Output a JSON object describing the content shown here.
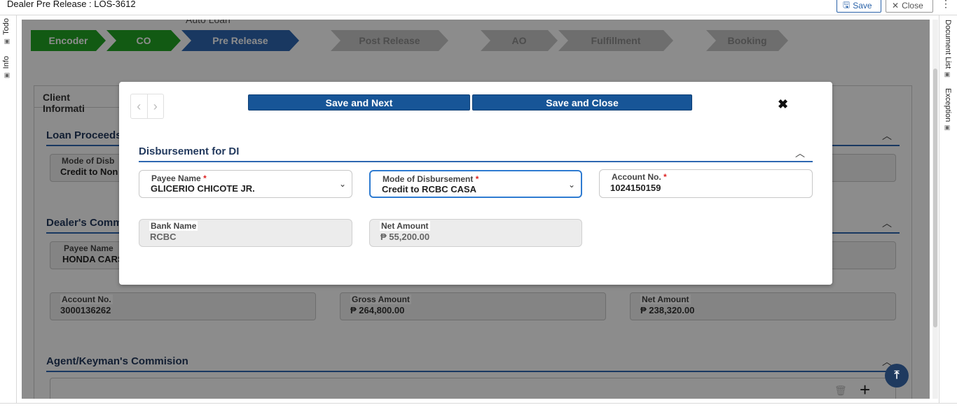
{
  "window": {
    "title": "Dealer Pre Release : LOS-3612",
    "save_label": "Save",
    "close_label": "Close",
    "more_icon": "⋮"
  },
  "left_tabs": [
    "Todo",
    "Info"
  ],
  "right_tabs": [
    "Document List",
    "Exception"
  ],
  "header": {
    "sub_label": "Auto Loan"
  },
  "stepper": [
    {
      "label": "Encoder",
      "state": "done"
    },
    {
      "label": "CO",
      "state": "done"
    },
    {
      "label": "Pre Release",
      "state": "active"
    },
    {
      "label": "Post Release",
      "state": "todo"
    },
    {
      "label": "AO",
      "state": "todo"
    },
    {
      "label": "Fulfillment",
      "state": "todo"
    },
    {
      "label": "Booking",
      "state": "todo"
    }
  ],
  "background_form": {
    "tab_label": "Client Informati",
    "loan_proceeds": {
      "title": "Loan Proceeds",
      "mode_label": "Mode of Disb",
      "mode_value": "Credit to Non"
    },
    "dealers_commission": {
      "title": "Dealer's Comm",
      "payee_label": "Payee Name",
      "payee_value": "HONDA CARS",
      "account_label": "Account No.",
      "account_value": "3000136262",
      "gross_label": "Gross Amount",
      "gross_value": "₱ 264,800.00",
      "net_label": "Net Amount",
      "net_value": "₱ 238,320.00"
    },
    "agent_commission": {
      "title": "Agent/Keyman's Commision"
    }
  },
  "modal": {
    "save_next_label": "Save and Next",
    "save_close_label": "Save and Close",
    "close_icon": "✖",
    "section_title": "Disbursement for DI",
    "fields": {
      "payee": {
        "label": "Payee Name",
        "value": "GLICERIO CHICOTE JR."
      },
      "mode": {
        "label": "Mode of Disbursement",
        "value": "Credit to RCBC CASA"
      },
      "account": {
        "label": "Account No.",
        "value": "1024150159"
      },
      "bank": {
        "label": "Bank Name",
        "value": "RCBC"
      },
      "net": {
        "label": "Net Amount",
        "value": "₱ 55,200.00"
      }
    },
    "required_mark": "*"
  },
  "colors": {
    "step_done": "#22a524",
    "step_active": "#2e67b1",
    "step_todo": "#c9c9c9",
    "primary_button": "#175597",
    "section_line": "#2e67b1"
  }
}
